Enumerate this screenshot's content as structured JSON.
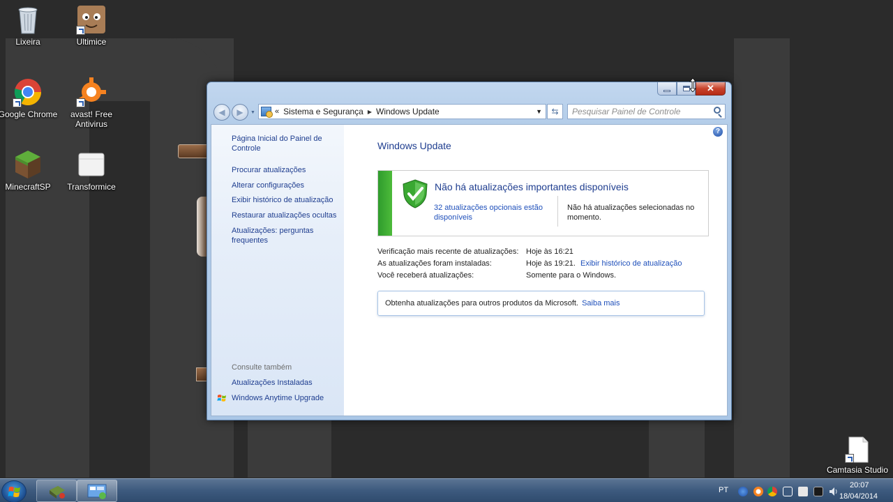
{
  "desktop": {
    "icons": [
      {
        "label": "Lixeira"
      },
      {
        "label": "Ultimice"
      },
      {
        "label": "Google Chrome"
      },
      {
        "label": "avast! Free Antivirus"
      },
      {
        "label": "MinecraftSP"
      },
      {
        "label": "Transformice"
      },
      {
        "label": "Camtasia Studio"
      }
    ]
  },
  "window": {
    "breadcrumb": {
      "item1": "Sistema e Segurança",
      "item2": "Windows Update"
    },
    "search_placeholder": "Pesquisar Painel de Controle",
    "sidebar": {
      "home_link": "Página Inicial do Painel de Controle",
      "links": [
        "Procurar atualizações",
        "Alterar configurações",
        "Exibir histórico de atualização",
        "Restaurar atualizações ocultas",
        "Atualizações: perguntas frequentes"
      ],
      "see_also_label": "Consulte também",
      "see_also": [
        "Atualizações Instaladas",
        "Windows Anytime Upgrade"
      ]
    },
    "main": {
      "title": "Windows Update",
      "status_heading": "Não há atualizações importantes disponíveis",
      "optional_link": "32 atualizações opcionais estão disponíveis",
      "selected_text": "Não há atualizações selecionadas no momento.",
      "info": [
        {
          "label": "Verificação mais recente de atualizações:",
          "value": "Hoje às 16:21"
        },
        {
          "label": "As atualizações foram instaladas:",
          "value": "Hoje às 19:21.",
          "link": "Exibir histórico de atualização"
        },
        {
          "label": "Você receberá atualizações:",
          "value": "Somente para o Windows."
        }
      ],
      "ms_text": "Obtenha atualizações para outros produtos da Microsoft.",
      "ms_link": "Saiba mais"
    }
  },
  "taskbar": {
    "language": "PT",
    "time": "20:07",
    "date": "18/04/2014"
  },
  "colors": {
    "link": "#1e4fba",
    "heading": "#1e3d8f",
    "status_green": "#3aa832"
  }
}
